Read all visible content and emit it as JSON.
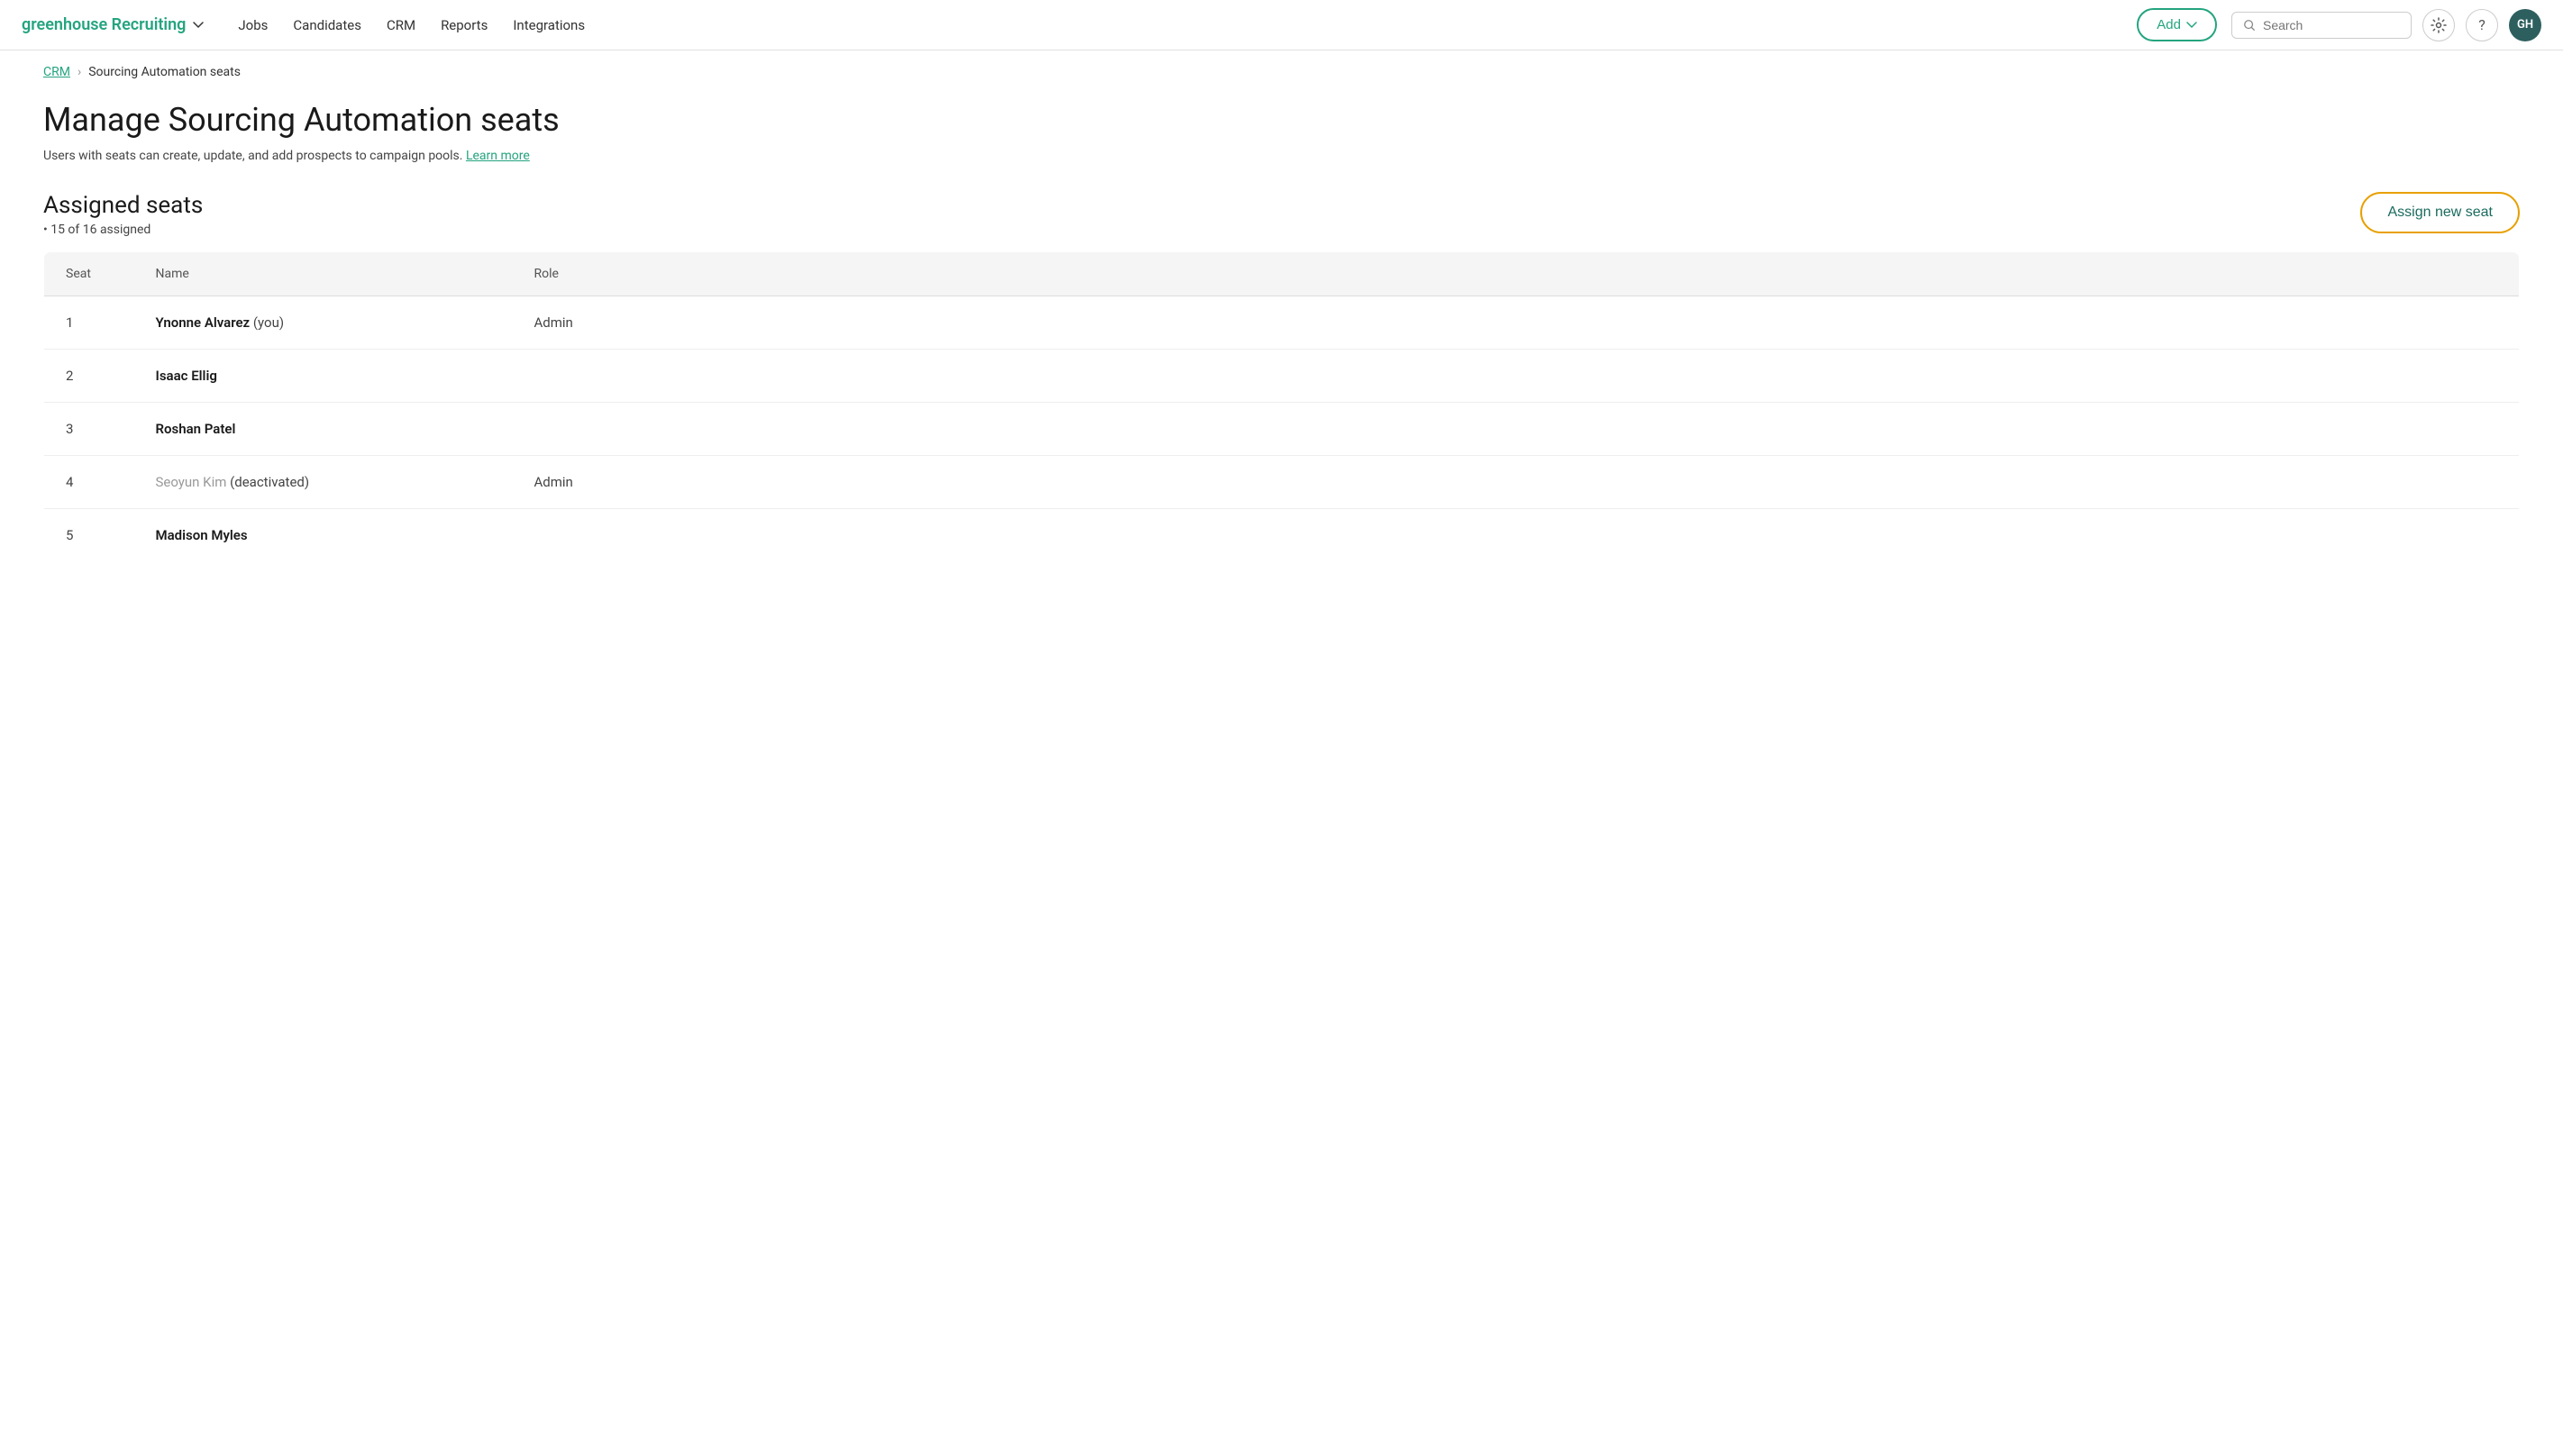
{
  "navbar": {
    "logo": "greenhouse",
    "logo_brand": "Recruiting",
    "nav_items": [
      {
        "label": "Jobs",
        "id": "jobs"
      },
      {
        "label": "Candidates",
        "id": "candidates"
      },
      {
        "label": "CRM",
        "id": "crm"
      },
      {
        "label": "Reports",
        "id": "reports"
      },
      {
        "label": "Integrations",
        "id": "integrations"
      }
    ],
    "add_button": "Add",
    "search_placeholder": "Search",
    "avatar_initials": "GH"
  },
  "breadcrumb": {
    "crm_label": "CRM",
    "separator": "›",
    "current": "Sourcing Automation seats"
  },
  "page": {
    "title": "Manage Sourcing Automation seats",
    "subtitle": "Users with seats can create, update, and add prospects to campaign pools.",
    "learn_more": "Learn more"
  },
  "assigned_seats": {
    "section_title": "Assigned seats",
    "count_label": "• 15 of 16 assigned",
    "assign_btn": "Assign new seat"
  },
  "table": {
    "headers": [
      "Seat",
      "Name",
      "Role"
    ],
    "rows": [
      {
        "seat": "1",
        "name": "Ynonne Alvarez",
        "name_suffix": " (you)",
        "role": "Admin",
        "deactivated": false
      },
      {
        "seat": "2",
        "name": "Isaac Ellig",
        "name_suffix": "",
        "role": "",
        "deactivated": false
      },
      {
        "seat": "3",
        "name": "Roshan Patel",
        "name_suffix": "",
        "role": "",
        "deactivated": false
      },
      {
        "seat": "4",
        "name": "Seoyun Kim",
        "name_suffix": " (deactivated)",
        "role": "Admin",
        "deactivated": true
      },
      {
        "seat": "5",
        "name": "Madison Myles",
        "name_suffix": "",
        "role": "",
        "deactivated": false
      }
    ]
  }
}
